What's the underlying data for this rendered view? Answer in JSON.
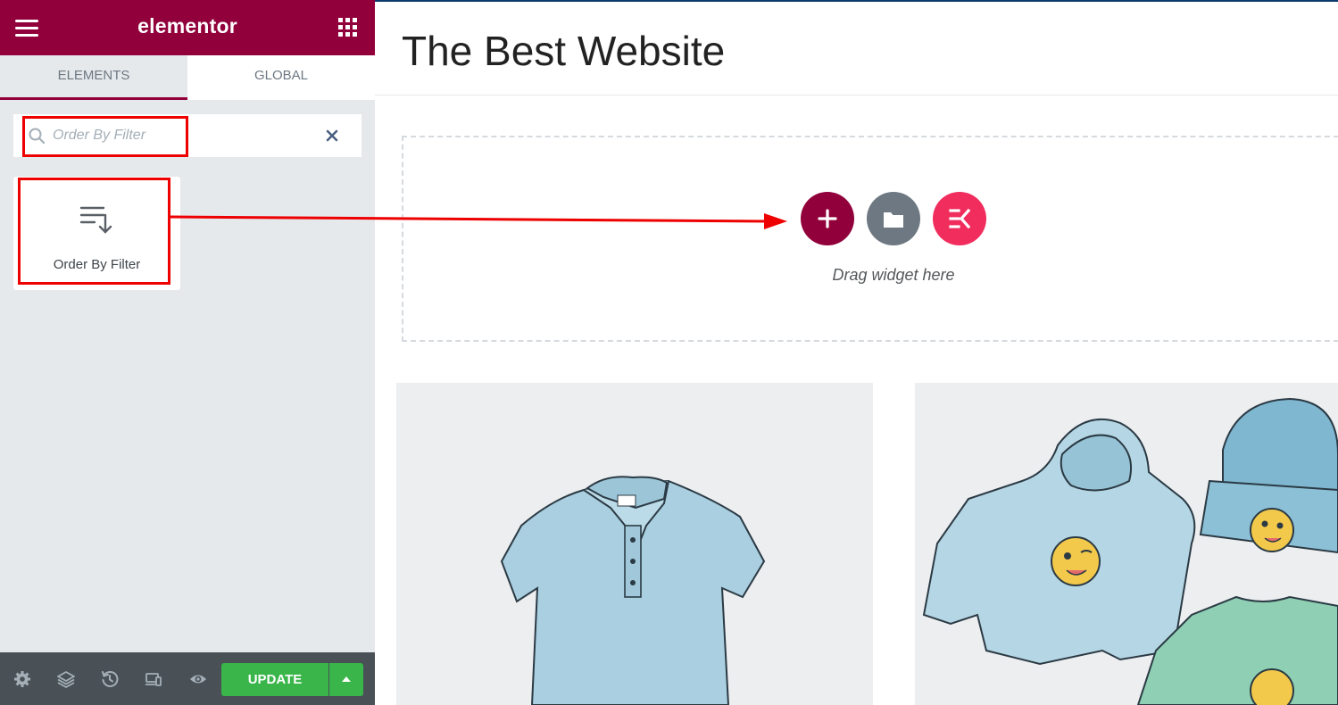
{
  "sidebar": {
    "brand": "elementor",
    "tabs": [
      {
        "label": "ELEMENTS",
        "active": true
      },
      {
        "label": "GLOBAL",
        "active": false
      }
    ],
    "search": {
      "value": "",
      "placeholder": "Order By Filter"
    },
    "widget": {
      "label": "Order By Filter",
      "icon": "sort-descending-icon"
    },
    "footer": {
      "icons": [
        "settings-icon",
        "layers-icon",
        "history-icon",
        "responsive-icon",
        "preview-icon"
      ],
      "update_label": "UPDATE"
    }
  },
  "canvas": {
    "page_title": "The Best Website",
    "drag_label": "Drag widget here",
    "buttons": [
      "add-section-icon",
      "template-library-icon",
      "elementskit-icon"
    ]
  },
  "colors": {
    "brand": "#92003b",
    "update": "#39b54a",
    "annotation": "#ee0000",
    "ek": "#f12d5d"
  }
}
